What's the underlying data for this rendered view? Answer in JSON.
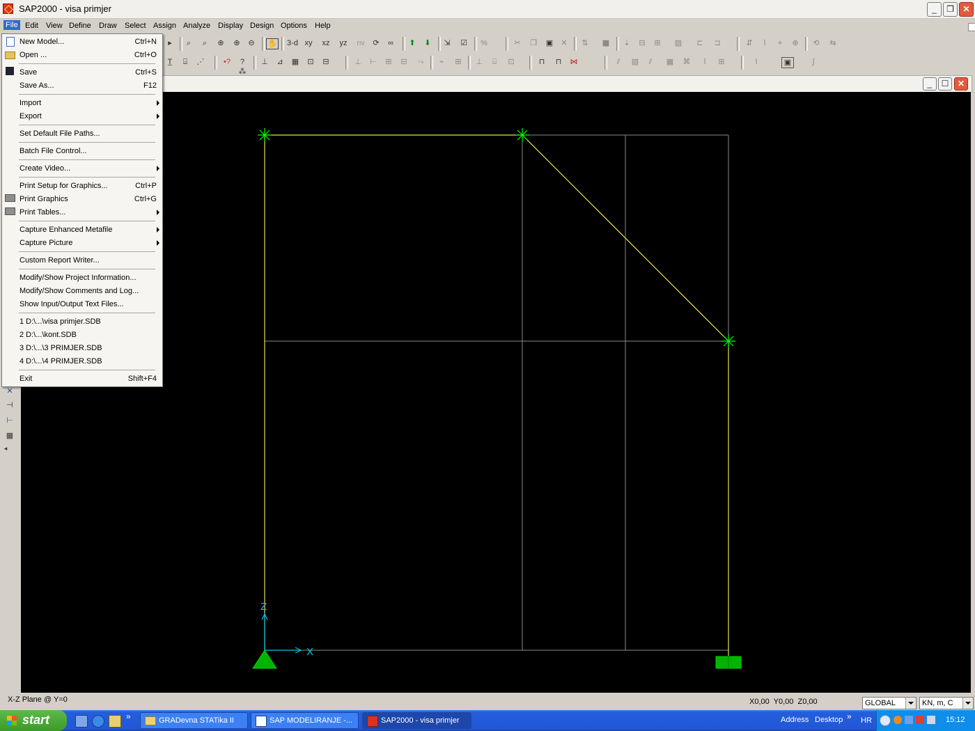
{
  "window": {
    "title": "SAP2000 - visa primjer"
  },
  "menubar": [
    "File",
    "Edit",
    "View",
    "Define",
    "Draw",
    "Select",
    "Assign",
    "Analyze",
    "Display",
    "Design",
    "Options",
    "Help"
  ],
  "toolbar": {
    "view_3d": "3-d",
    "view_xy": "xy",
    "view_xz": "xz",
    "view_yz": "yz",
    "view_nv": "nv"
  },
  "file_menu": {
    "items": [
      {
        "label": "New Model...",
        "shortcut": "Ctrl+N",
        "icon": "new-file-icon"
      },
      {
        "label": "Open ...",
        "shortcut": "Ctrl+O",
        "icon": "open-folder-icon"
      },
      {
        "label": "Save",
        "shortcut": "Ctrl+S",
        "icon": "floppy-disk-icon"
      },
      {
        "label": "Save As...",
        "shortcut": "F12"
      },
      {
        "label": "Import",
        "submenu": true
      },
      {
        "label": "Export",
        "submenu": true
      },
      {
        "label": "Set Default File Paths..."
      },
      {
        "label": "Batch File Control..."
      },
      {
        "label": "Create Video...",
        "submenu": true
      },
      {
        "label": "Print Setup for Graphics...",
        "shortcut": "Ctrl+P"
      },
      {
        "label": "Print Graphics",
        "shortcut": "Ctrl+G",
        "icon": "printer-icon"
      },
      {
        "label": "Print Tables...",
        "submenu": true,
        "icon": "printer-icon"
      },
      {
        "label": "Capture Enhanced Metafile",
        "submenu": true
      },
      {
        "label": "Capture Picture",
        "submenu": true
      },
      {
        "label": "Custom Report Writer..."
      },
      {
        "label": "Modify/Show Project Information..."
      },
      {
        "label": "Modify/Show Comments and Log..."
      },
      {
        "label": "Show Input/Output Text Files..."
      },
      {
        "label": "1 D:\\...\\visa primjer.SDB"
      },
      {
        "label": "2 D:\\...\\kont.SDB"
      },
      {
        "label": "3 D:\\...\\3 PRIMJER.SDB"
      },
      {
        "label": "4 D:\\...\\4 PRIMJER.SDB"
      },
      {
        "label": "Exit",
        "shortcut": "Shift+F4"
      }
    ]
  },
  "canvas": {
    "axis_z_label": "Z",
    "axis_x_label": "X",
    "colors": {
      "background": "#000000",
      "frame": "#e6e64a",
      "grid": "#8a8a8a",
      "joint": "#00ff00",
      "axis": "#00c8e6",
      "support": "#00b400"
    }
  },
  "status": {
    "plane": "X-Z Plane @ Y=0",
    "coords": "X0,00  Y0,00  Z0,00",
    "coord_system": "GLOBAL",
    "units": "KN, m, C"
  },
  "taskbar": {
    "start": "start",
    "tasks": [
      "GRADevna  STATika  II",
      "SAP  MODELIRANJE -...",
      "SAP2000 - visa primjer"
    ],
    "address": "Address",
    "desktop": "Desktop",
    "lang": "HR",
    "clock": "15:12"
  }
}
